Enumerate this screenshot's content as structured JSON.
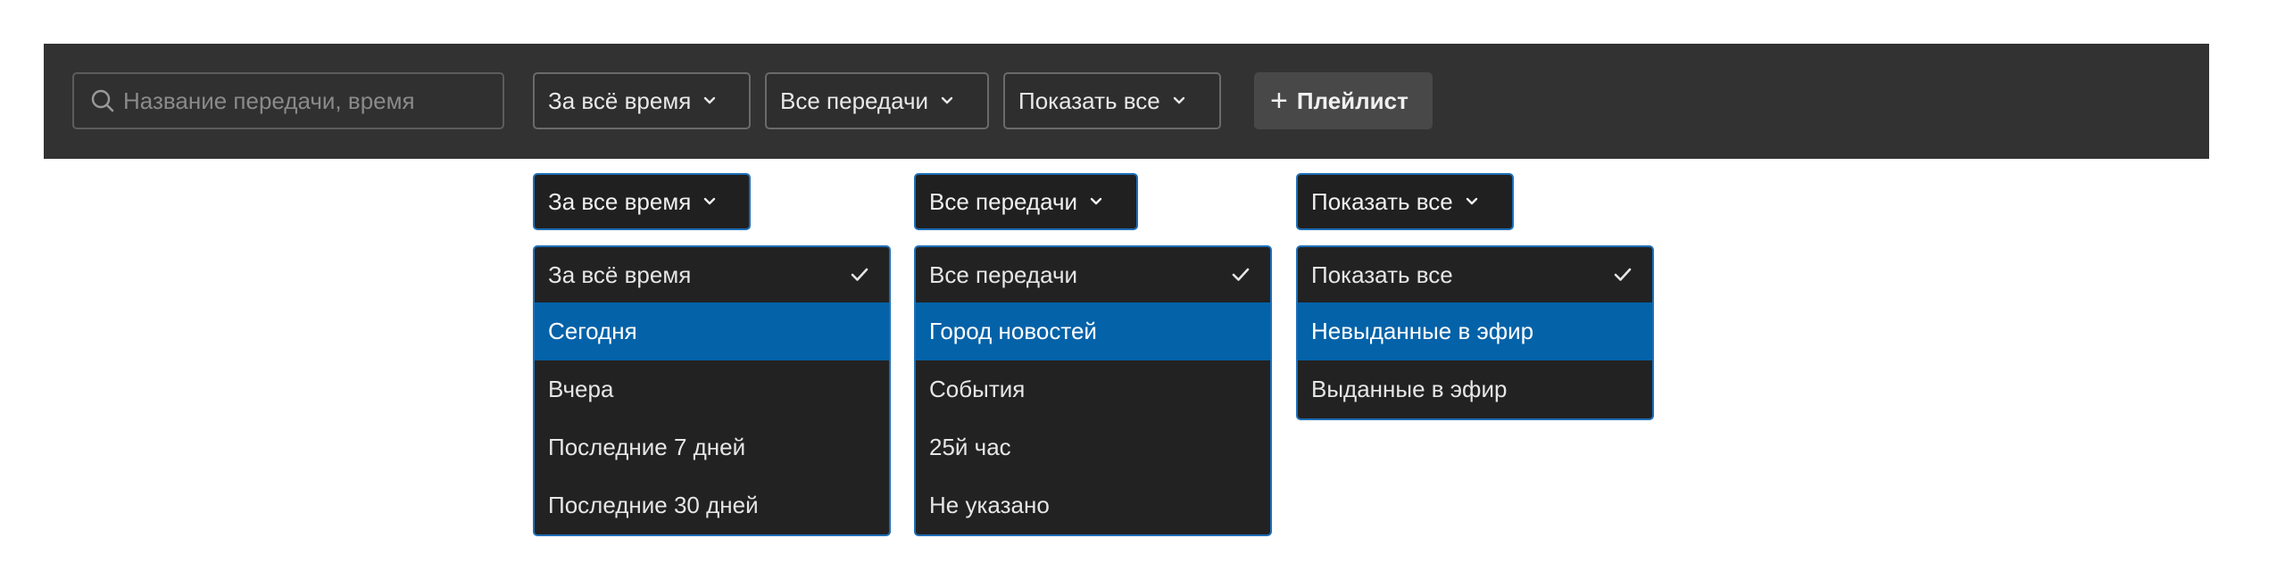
{
  "toolbar": {
    "search": {
      "placeholder": "Название передачи, время",
      "value": ""
    },
    "filters": [
      {
        "label": "За всё время",
        "icon": "chevron-down-icon"
      },
      {
        "label": "Все передачи",
        "icon": "chevron-down-icon"
      },
      {
        "label": "Показать все",
        "icon": "chevron-down-icon"
      }
    ],
    "playlist": {
      "icon": "plus-icon",
      "label": "Плейлист"
    }
  },
  "dropdowns": [
    {
      "selected_label": "За все время",
      "options": [
        "За всё время",
        "Сегодня",
        "Вчера",
        "Последние 7 дней",
        "Последние 30 дней"
      ],
      "checked_index": 0,
      "highlighted_index": 1
    },
    {
      "selected_label": "Все передачи",
      "options": [
        "Все передачи",
        "Город новостей",
        "События",
        "25й час",
        "Не указано"
      ],
      "checked_index": 0,
      "highlighted_index": 1
    },
    {
      "selected_label": "Показать все",
      "options": [
        "Показать все",
        "Невыданные в эфир",
        "Выданные в эфир"
      ],
      "checked_index": 0,
      "highlighted_index": 1
    }
  ],
  "colors": {
    "toolbar_bg": "#323232",
    "menu_bg": "#222222",
    "accent_border": "#1e6fb8",
    "highlight": "#0462a8"
  }
}
